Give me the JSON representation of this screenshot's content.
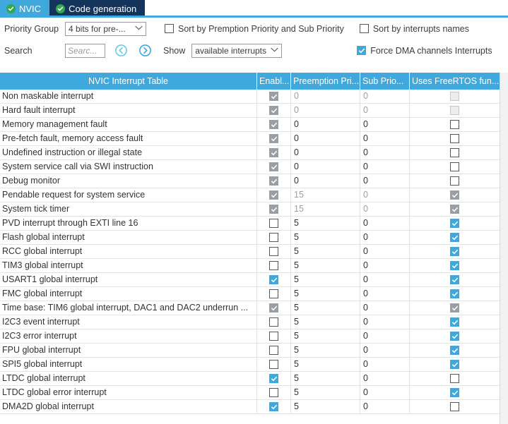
{
  "tabs": [
    {
      "label": "NVIC",
      "icon": "check-circle-icon",
      "active": true
    },
    {
      "label": "Code generation",
      "icon": "check-circle-icon",
      "active": false
    }
  ],
  "toolbar": {
    "priority_group_label": "Priority Group",
    "priority_group_value": "4 bits for pre-...",
    "sort_premption_label": "Sort by Premption Priority and Sub Priority",
    "sort_premption_checked": false,
    "sort_names_label": "Sort by interrupts names",
    "sort_names_checked": false,
    "search_label": "Search",
    "search_value": "",
    "search_placeholder": "Searc...",
    "prev_icon": "circle-left-arrow-icon",
    "next_icon": "circle-right-arrow-icon",
    "show_label": "Show",
    "show_value": "available interrupts",
    "force_dma_label": "Force DMA channels Interrupts",
    "force_dma_checked": true
  },
  "colors": {
    "accent": "#3fa9dd",
    "tab_inactive": "#15345c",
    "check_badge": "#2fa84f",
    "disabled": "#9a9fa5",
    "row_border": "#e3e3e3"
  },
  "table": {
    "columns": [
      {
        "label": "NVIC Interrupt Table",
        "align": "center"
      },
      {
        "label": "Enabl...",
        "align": "left"
      },
      {
        "label": "Preemption Pri...",
        "align": "left"
      },
      {
        "label": "Sub Prio...",
        "align": "left"
      },
      {
        "label": "Uses FreeRTOS fun...",
        "align": "left"
      }
    ],
    "rows": [
      {
        "name": "Non maskable interrupt",
        "enabled": "disabled-checked",
        "preemption": "0",
        "sub": "0",
        "rtos": "disabled-unchecked",
        "muted": true
      },
      {
        "name": "Hard fault interrupt",
        "enabled": "disabled-checked",
        "preemption": "0",
        "sub": "0",
        "rtos": "disabled-unchecked",
        "muted": true
      },
      {
        "name": "Memory management fault",
        "enabled": "disabled-checked",
        "preemption": "0",
        "sub": "0",
        "rtos": "unchecked",
        "muted": false
      },
      {
        "name": "Pre-fetch fault, memory access fault",
        "enabled": "disabled-checked",
        "preemption": "0",
        "sub": "0",
        "rtos": "unchecked",
        "muted": false
      },
      {
        "name": "Undefined instruction or illegal state",
        "enabled": "disabled-checked",
        "preemption": "0",
        "sub": "0",
        "rtos": "unchecked",
        "muted": false
      },
      {
        "name": "System service call via SWI instruction",
        "enabled": "disabled-checked",
        "preemption": "0",
        "sub": "0",
        "rtos": "unchecked",
        "muted": false
      },
      {
        "name": "Debug monitor",
        "enabled": "disabled-checked",
        "preemption": "0",
        "sub": "0",
        "rtos": "unchecked",
        "muted": false
      },
      {
        "name": "Pendable request for system service",
        "enabled": "disabled-checked",
        "preemption": "15",
        "sub": "0",
        "rtos": "disabled-checked",
        "muted": true
      },
      {
        "name": "System tick timer",
        "enabled": "disabled-checked",
        "preemption": "15",
        "sub": "0",
        "rtos": "disabled-checked",
        "muted": true
      },
      {
        "name": "PVD interrupt through EXTI line 16",
        "enabled": "unchecked",
        "preemption": "5",
        "sub": "0",
        "rtos": "checked",
        "muted": false
      },
      {
        "name": "Flash global interrupt",
        "enabled": "unchecked",
        "preemption": "5",
        "sub": "0",
        "rtos": "checked",
        "muted": false
      },
      {
        "name": "RCC global interrupt",
        "enabled": "unchecked",
        "preemption": "5",
        "sub": "0",
        "rtos": "checked",
        "muted": false
      },
      {
        "name": "TIM3 global interrupt",
        "enabled": "unchecked",
        "preemption": "5",
        "sub": "0",
        "rtos": "checked",
        "muted": false
      },
      {
        "name": "USART1 global interrupt",
        "enabled": "checked",
        "preemption": "5",
        "sub": "0",
        "rtos": "checked",
        "muted": false
      },
      {
        "name": "FMC global interrupt",
        "enabled": "unchecked",
        "preemption": "5",
        "sub": "0",
        "rtos": "checked",
        "muted": false
      },
      {
        "name": "Time base: TIM6 global interrupt, DAC1 and DAC2 underrun ...",
        "enabled": "disabled-checked",
        "preemption": "5",
        "sub": "0",
        "rtos": "disabled-checked",
        "muted": false
      },
      {
        "name": "I2C3 event interrupt",
        "enabled": "unchecked",
        "preemption": "5",
        "sub": "0",
        "rtos": "checked",
        "muted": false
      },
      {
        "name": "I2C3 error interrupt",
        "enabled": "unchecked",
        "preemption": "5",
        "sub": "0",
        "rtos": "checked",
        "muted": false
      },
      {
        "name": "FPU global interrupt",
        "enabled": "unchecked",
        "preemption": "5",
        "sub": "0",
        "rtos": "checked",
        "muted": false
      },
      {
        "name": "SPI5 global interrupt",
        "enabled": "unchecked",
        "preemption": "5",
        "sub": "0",
        "rtos": "checked",
        "muted": false
      },
      {
        "name": "LTDC global interrupt",
        "enabled": "checked",
        "preemption": "5",
        "sub": "0",
        "rtos": "unchecked",
        "muted": false
      },
      {
        "name": "LTDC global error interrupt",
        "enabled": "unchecked",
        "preemption": "5",
        "sub": "0",
        "rtos": "checked",
        "muted": false
      },
      {
        "name": "DMA2D global interrupt",
        "enabled": "checked",
        "preemption": "5",
        "sub": "0",
        "rtos": "unchecked",
        "muted": false
      }
    ]
  }
}
